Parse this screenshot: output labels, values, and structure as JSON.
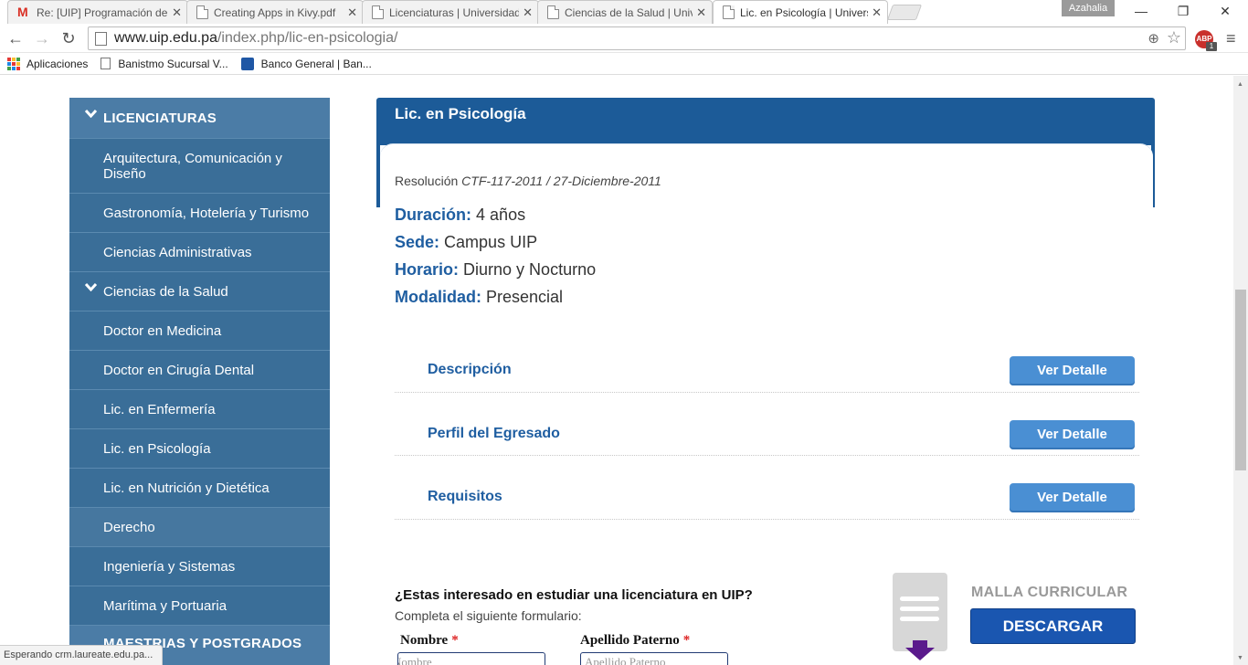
{
  "browser": {
    "tabs": [
      {
        "title": "Re: [UIP] Programación de",
        "icon": "gmail"
      },
      {
        "title": "Creating Apps in Kivy.pdf",
        "icon": "doc"
      },
      {
        "title": "Licenciaturas | Universidad",
        "icon": "doc"
      },
      {
        "title": "Ciencias de la Salud | Univ",
        "icon": "doc"
      },
      {
        "title": "Lic. en Psicología | Univers",
        "icon": "doc",
        "active": true
      }
    ],
    "profile": "Azahalia",
    "window": {
      "minimize": "—",
      "restore": "❐",
      "close": "✕"
    },
    "url_host": "www.uip.edu.pa",
    "url_path": "/index.php/lic-en-psicologia/",
    "abp_label": "ABP",
    "abp_count": "1",
    "bookmarks": [
      {
        "label": "Aplicaciones",
        "icon": "apps-grid"
      },
      {
        "label": "Banistmo Sucursal V...",
        "icon": "doc"
      },
      {
        "label": "Banco General | Ban...",
        "icon": "bank"
      }
    ],
    "status_text": "Esperando crm.laureate.edu.pa..."
  },
  "sidebar": {
    "items": [
      {
        "label": "LICENCIATURAS",
        "type": "head",
        "chevron": true
      },
      {
        "label": "Arquitectura, Comunicación y Diseño"
      },
      {
        "label": "Gastronomía, Hotelería y Turismo"
      },
      {
        "label": "Ciencias Administrativas"
      },
      {
        "label": "Ciencias de la Salud",
        "chevron": true
      },
      {
        "label": "Doctor en Medicina"
      },
      {
        "label": "Doctor en Cirugía Dental"
      },
      {
        "label": "Lic. en Enfermería"
      },
      {
        "label": "Lic. en Psicología"
      },
      {
        "label": "Lic. en Nutrición y Dietética"
      },
      {
        "label": "Derecho",
        "alt": true
      },
      {
        "label": "Ingeniería y Sistemas"
      },
      {
        "label": "Marítima y Portuaria"
      },
      {
        "label": "MAESTRIAS Y POSTGRADOS",
        "type": "head"
      }
    ]
  },
  "main": {
    "title": "Lic. en Psicología",
    "resolucion_label": "Resolución",
    "resolucion_value": "CTF-117-2011 / 27-Diciembre-2011",
    "facts": [
      {
        "label": "Duración:",
        "value": "4 años"
      },
      {
        "label": "Sede:",
        "value": "Campus UIP"
      },
      {
        "label": "Horario:",
        "value": "Diurno y Nocturno"
      },
      {
        "label": "Modalidad:",
        "value": "Presencial"
      }
    ],
    "sections": [
      {
        "title": "Descripción",
        "button": "Ver Detalle"
      },
      {
        "title": "Perfil del Egresado",
        "button": "Ver Detalle"
      },
      {
        "title": "Requisitos",
        "button": "Ver Detalle"
      }
    ],
    "form": {
      "question": "¿Estas interesado en estudiar una licenciatura en UIP?",
      "subtitle": "Completa el siguiente formulario:",
      "fields": [
        {
          "label": "Nombre",
          "required": "*",
          "placeholder": "Nombre"
        },
        {
          "label": "Apellido Paterno",
          "required": "*",
          "placeholder": "Apellido Paterno"
        }
      ]
    },
    "malla": {
      "label": "MALLA CURRICULAR",
      "button": "DESCARGAR"
    }
  }
}
